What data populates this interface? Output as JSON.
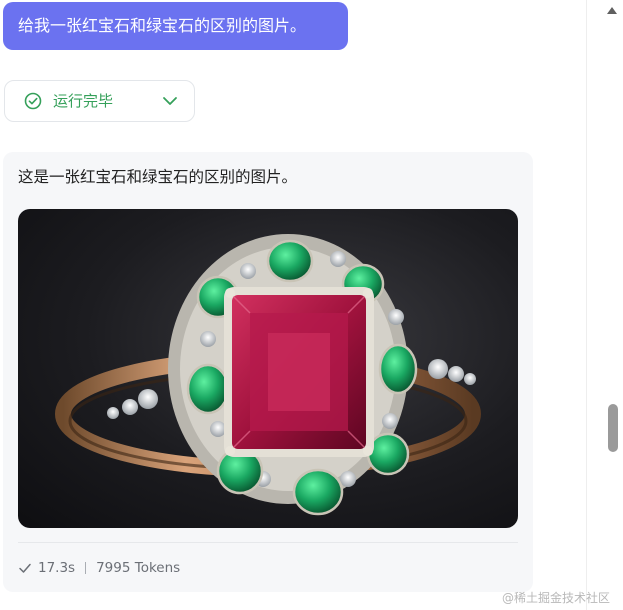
{
  "chat": {
    "user_message": "给我一张红宝石和绿宝石的区别的图片。",
    "status": {
      "label": "运行完毕",
      "icon": "check-circle-icon",
      "color": "#35a05a"
    },
    "answer": {
      "text": "这是一张红宝石和绿宝石的区别的图片。",
      "image_subject": "ruby-and-emerald-ring",
      "duration": "17.3s",
      "tokens": "7995 Tokens"
    }
  },
  "colors": {
    "user_bubble": "#6b72f0",
    "card_background": "#f6f7f9"
  },
  "watermark": "@稀土掘金技术社区"
}
